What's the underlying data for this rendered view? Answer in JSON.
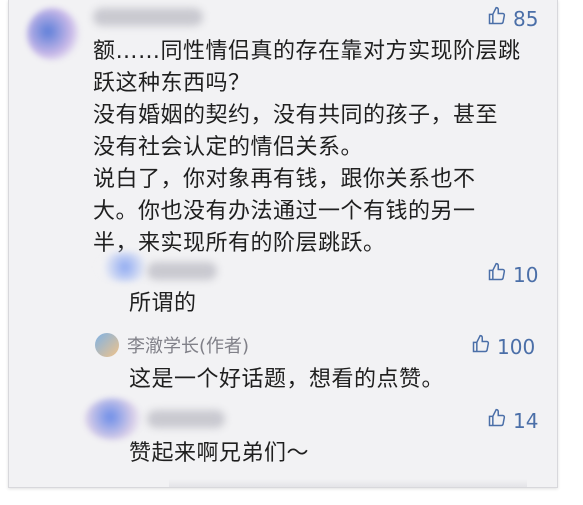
{
  "comments": [
    {
      "likes": "85",
      "text_lines": [
        "额……同性情侣真的存在靠对方实现阶层跳",
        "跃这种东西吗？",
        "没有婚姻的契约，没有共同的孩子，甚至",
        "没有社会认定的情侣关系。",
        "说白了，你对象再有钱，跟你关系也不",
        "大。你也没有办法通过一个有钱的另一",
        "半，来实现所有的阶层跳跃。"
      ]
    },
    {
      "likes": "10",
      "text": "所谓的"
    },
    {
      "author": "李澈学长(作者)",
      "likes": "100",
      "text": "这是一个好话题，想看的点赞。"
    },
    {
      "likes": "14",
      "text": "赞起来啊兄弟们～"
    }
  ],
  "icons": {
    "like": "thumbs-up-icon",
    "avatar": "avatar-icon"
  },
  "colors": {
    "like": "#4b6fa8",
    "background": "#f2f2f4",
    "text": "#1f1f1f",
    "author": "#808088"
  }
}
